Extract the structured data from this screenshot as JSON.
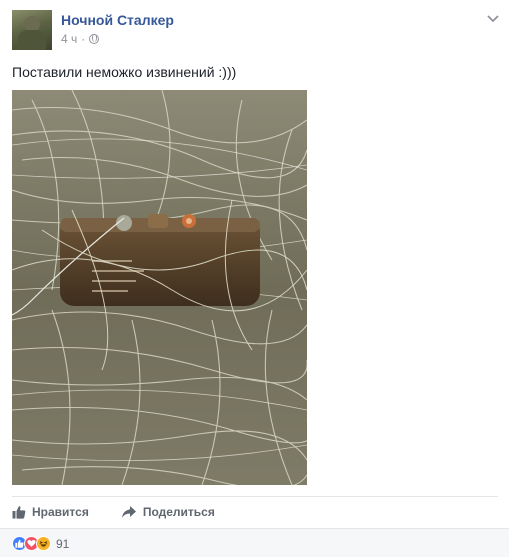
{
  "post": {
    "author": "Ночной Сталкер",
    "time": "4 ч",
    "separator": "·",
    "text": "Поставили неможко извинений :)))"
  },
  "actions": {
    "like_label": "Нравится",
    "share_label": "Поделиться"
  },
  "reactions": {
    "icons": [
      "like-icon",
      "love-icon",
      "haha-icon"
    ],
    "count": "91"
  },
  "colors": {
    "author_link": "#365899",
    "meta_gray": "#90949c",
    "action_gray": "#606770",
    "like_blue": "#4080ff",
    "love_red": "#f25268",
    "haha_yellow": "#f7b125"
  }
}
